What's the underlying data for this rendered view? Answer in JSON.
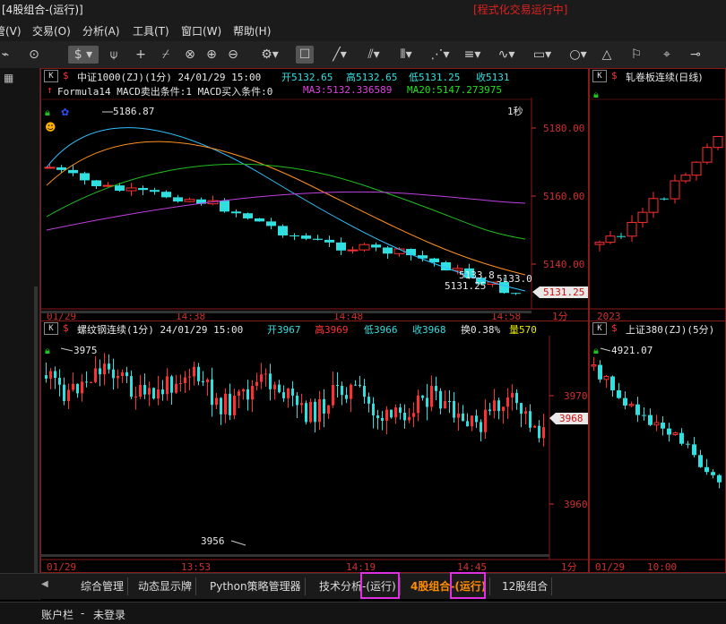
{
  "window": {
    "title": "[4股组合-(运行)]",
    "status": "[程式化交易运行中]"
  },
  "menu": {
    "items": [
      "管(V)",
      "交易(O)",
      "分析(A)",
      "工具(T)",
      "窗口(W)",
      "帮助(H)"
    ]
  },
  "toolbar": {
    "icons": [
      "play-icon",
      "dollar-icon",
      "filter-icon",
      "crosshair-icon",
      "connect-icon",
      "zoom-in-icon",
      "zoom-out-icon",
      "gear-icon",
      "hand-icon",
      "line-tool-icon",
      "multi-line-icon",
      "fan-icon",
      "channel-icon",
      "rect-icon",
      "circle-icon",
      "triangle-icon"
    ]
  },
  "panels": {
    "top_left": {
      "header1": {
        "name": "中证1000(ZJ)(1分) 24/01/29 15:00",
        "open": "开5132.65",
        "high": "高5132.65",
        "low": "低5131.25",
        "close": "收5131"
      },
      "header2": {
        "formula": "Formula14 MACD卖出条件:1 MACD买入条件:0",
        "ma3": "MA3:5132.336589",
        "ma20": "MA20:5147.273975"
      },
      "interval_label": "1秒",
      "high_annot": "5186.87",
      "low_annot": "5131.25",
      "mid_annot": "5133.8",
      "mid_annot2": "5133.0",
      "price_ticks": [
        "5180.00",
        "5160.00",
        "5140.00"
      ],
      "last_price": "5131.25",
      "time_ticks": [
        "01/29",
        "14:38",
        "14:48",
        "14:58"
      ],
      "period": "1分"
    },
    "top_right": {
      "name": "轧卷板连续(日线)",
      "time_ticks": [
        "2023"
      ]
    },
    "bottom_left": {
      "header1": {
        "name": "螺纹钢连续(1分) 24/01/29 15:00",
        "open": "开3967",
        "high": "高3969",
        "low": "低3966",
        "close": "收3968",
        "turn": "换0.38%",
        "vol": "量570"
      },
      "high_annot": "3975",
      "low_annot": "3956",
      "price_ticks": [
        "3970",
        "3960"
      ],
      "last_price": "3968",
      "time_ticks": [
        "01/29",
        "13:53",
        "14:19",
        "14:45"
      ],
      "period": "1分"
    },
    "bottom_right": {
      "name": "上证380(ZJ)(5分)",
      "high_annot": "4921.07",
      "time_ticks": [
        "01/29",
        "10:00"
      ]
    }
  },
  "tabs": [
    {
      "label": "综合管理",
      "active": false
    },
    {
      "label": "动态显示牌",
      "active": false
    },
    {
      "label": "Python策略管理器",
      "active": false
    },
    {
      "label": "技术分析-(运行)",
      "active": false
    },
    {
      "label": "4股组合-(运行)",
      "active": true
    },
    {
      "label": "12股组合",
      "active": false
    }
  ],
  "status": {
    "label": "账户栏",
    "value": "未登录"
  },
  "colors": {
    "up": "#ff3030",
    "down": "#30e0e0",
    "frame": "#8a1a1a",
    "accent": "#ff8c00",
    "highlight": "#e030e0"
  }
}
